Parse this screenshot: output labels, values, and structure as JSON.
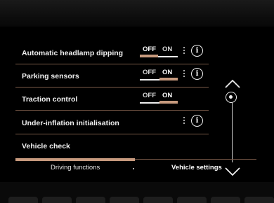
{
  "settings_list": {
    "rows": [
      {
        "label": "Automatic headlamp dipping",
        "toggle": {
          "off_label": "OFF",
          "on_label": "ON",
          "state": "off"
        },
        "has_more": true,
        "has_info": true
      },
      {
        "label": "Parking sensors",
        "toggle": {
          "off_label": "OFF",
          "on_label": "ON",
          "state": "on"
        },
        "has_more": true,
        "has_info": true
      },
      {
        "label": "Traction control",
        "toggle": {
          "off_label": "OFF",
          "on_label": "ON",
          "state": "on"
        },
        "has_more": false,
        "has_info": false
      },
      {
        "label": "Under-inflation initialisation",
        "has_more": true,
        "has_info": true
      },
      {
        "label": "Vehicle check"
      }
    ]
  },
  "icons": {
    "more": "more-vertical-icon",
    "info": "info-icon",
    "scroll_up": "chevron-up-icon",
    "scroll_down": "chevron-down-icon",
    "info_glyph": "i"
  },
  "tabs": [
    {
      "label": "Driving functions",
      "active": true
    },
    {
      "label": "Vehicle settings",
      "active": false
    }
  ],
  "colors": {
    "accent": "#c79a7e",
    "separator": "#7a5a48",
    "text": "#f0f0f0",
    "background": "#000000"
  }
}
